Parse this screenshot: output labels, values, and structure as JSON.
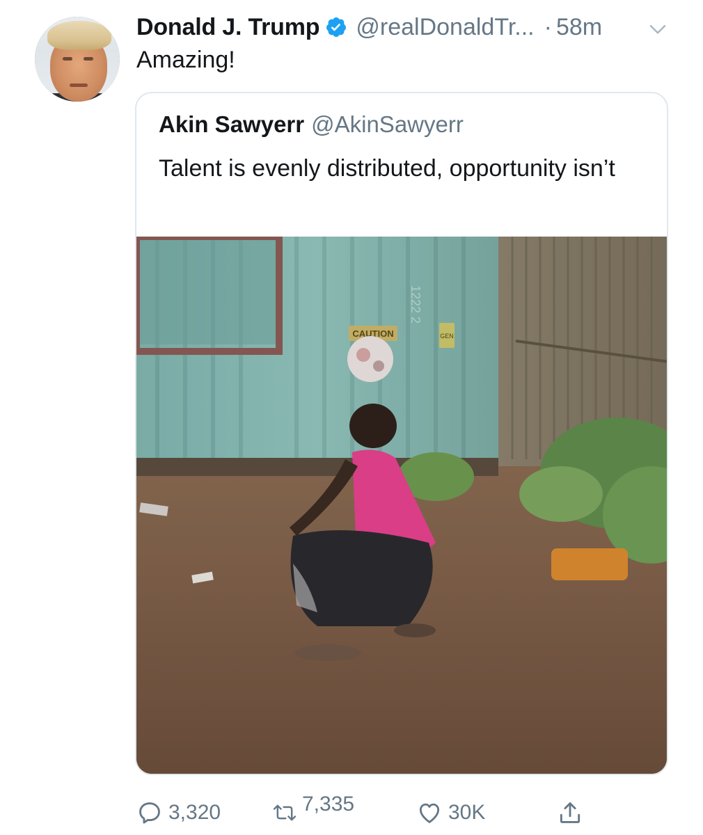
{
  "tweet": {
    "author": {
      "display_name": "Donald J. Trump",
      "handle": "@realDonaldTr...",
      "verified": true,
      "avatar_icon": "user-avatar"
    },
    "separator": "·",
    "time": "58m",
    "text": "Amazing!",
    "menu_icon": "chevron-down-icon"
  },
  "quoted": {
    "display_name": "Akin Sawyerr",
    "handle": "@AkinSawyerr",
    "text": "Talent is evenly distributed, opportunity isn’t",
    "media": {
      "kind": "video-frame",
      "sign_text": "CAUTION",
      "container_code": "1222 2",
      "label_plate": "GEN"
    }
  },
  "actions": {
    "reply": {
      "icon": "reply-icon",
      "count": "3,320"
    },
    "retweet": {
      "icon": "retweet-icon",
      "count": "7,335"
    },
    "like": {
      "icon": "heart-icon",
      "count": "30K"
    },
    "share": {
      "icon": "share-icon",
      "count": ""
    }
  },
  "colors": {
    "text": "#14171a",
    "secondary": "#657786",
    "verified": "#1da1f2",
    "card_border": "#e1e8ed"
  }
}
